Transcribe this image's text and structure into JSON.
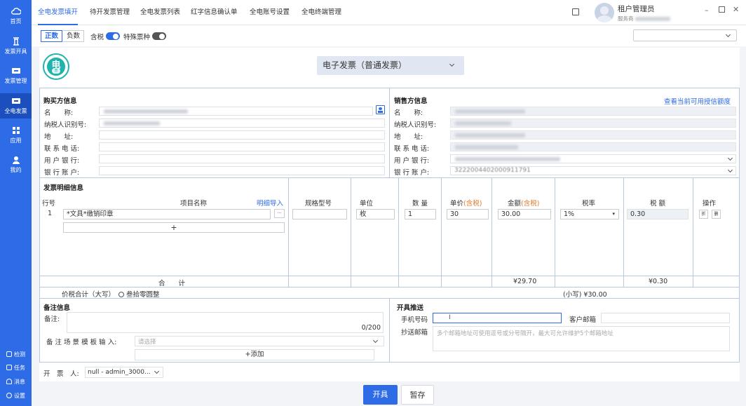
{
  "sidebar": {
    "items": [
      {
        "label": "首页",
        "icon": "cloud-icon"
      },
      {
        "label": "发票开具",
        "icon": "invoice-issue-icon"
      },
      {
        "label": "发票管理",
        "icon": "ticket-icon"
      },
      {
        "label": "全电发票",
        "icon": "ticket-icon"
      },
      {
        "label": "应用",
        "icon": "grid-icon"
      },
      {
        "label": "我的",
        "icon": "user-icon"
      }
    ],
    "bottom": [
      {
        "label": "检测",
        "icon": "check-icon"
      },
      {
        "label": "任务",
        "icon": "task-icon"
      },
      {
        "label": "消息",
        "icon": "bell-icon"
      },
      {
        "label": "设置",
        "icon": "gear-icon"
      }
    ]
  },
  "tabs": [
    "全电发票填开",
    "待开发票管理",
    "全电发票列表",
    "红字信息确认单",
    "全电账号设置",
    "全电终端管理"
  ],
  "user": {
    "name": "租户管理员",
    "org_prefix": "服务商"
  },
  "options": {
    "positive": "正数",
    "negative": "负数",
    "tax_included": "含税",
    "special_type": "特殊票种",
    "tax_included_on": true,
    "special_type_on": false
  },
  "logo_text": {
    "main": "电",
    "sub": "普"
  },
  "invoice_type": "电子发票（普通发票）",
  "buyer": {
    "title": "购买方信息",
    "labels": [
      "名　　称:",
      "纳税人识别号:",
      "地　　址:",
      "联 系 电 话:",
      "用 户 银 行:",
      "银 行 账 户:"
    ]
  },
  "seller": {
    "title": "销售方信息",
    "link": "查看当前可用授信额度",
    "labels": [
      "名　　称:",
      "纳税人识别号:",
      "地　　址:",
      "联 系 电 话:",
      "用 户 银 行:",
      "银 行 账 户:"
    ],
    "account_partial": "3222004402000911791"
  },
  "details": {
    "title": "发票明细信息",
    "headers": {
      "row_no": "行号",
      "item_name": "项目名称",
      "import_link": "明细导入",
      "spec": "规格型号",
      "unit": "单位",
      "qty": "数 量",
      "price": "单价",
      "price_suffix": "(含税)",
      "amount": "金额",
      "amount_suffix": "(含税)",
      "tax_rate": "税率",
      "tax": "税 额",
      "ops": "操作"
    },
    "row": {
      "no": "1",
      "item": "*文具*缴销印章",
      "spec": "",
      "unit": "枚",
      "qty": "1",
      "price": "30",
      "amount": "30.00",
      "tax_rate": "1%",
      "tax": "0.30",
      "op1": "折",
      "op2": "删"
    },
    "add": "+",
    "total_label": "合　　计",
    "total_amount": "¥29.70",
    "total_tax": "¥0.30",
    "sum_caps_label": "价税合计（大写）",
    "sum_caps_value": "叁拾零圆整",
    "sum_small": "(小写) ¥30.00"
  },
  "remarks": {
    "title": "备注信息",
    "label": "备注:",
    "counter": "0/200",
    "template_label": "备 注 场 景 模 板 输 入:",
    "template_placeholder": "请选择",
    "add": "+添加"
  },
  "push": {
    "title": "开具推送",
    "phone_label": "手机号码",
    "email_label": "客户邮箱",
    "cc_label": "抄送邮箱",
    "cc_placeholder": "多个邮箱地址可使用逗号或分号隔开，最大可允许维护5个邮箱地址"
  },
  "issuer": {
    "label": "开　票　人:",
    "value": "null - admin_3000..."
  },
  "buttons": {
    "issue": "开具",
    "save": "暂存"
  },
  "colors": {
    "primary": "#2e6be6",
    "accent": "#e07a2b",
    "logo": "#1fb3b0"
  }
}
